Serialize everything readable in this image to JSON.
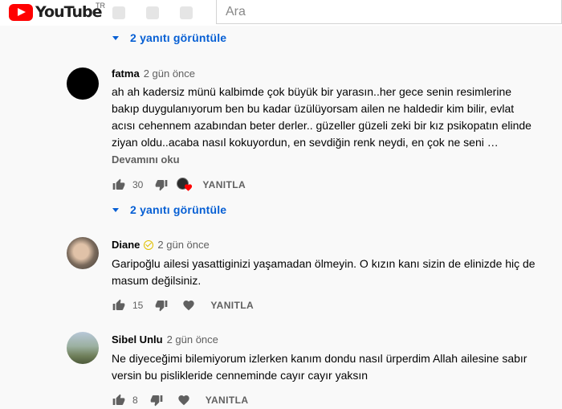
{
  "header": {
    "logo_text": "YouTube",
    "country": "TR",
    "search_placeholder": "Ara"
  },
  "reply_links": [
    {
      "label": "2 yanıtı görüntüle"
    },
    {
      "label": "2 yanıtı görüntüle"
    }
  ],
  "comments": [
    {
      "author": "fatma",
      "time": "2 gün önce",
      "verified": false,
      "lines": [
        "ah ah kadersiz münü kalbimde çok büyük bir yarasın..her gece senin resimlerine",
        "bakıp duygulanıyorum ben bu kadar üzülüyorsam ailen ne haldedir kim bilir, evlat",
        "acısı cehennem azabından beter derler.. güzeller güzeli zeki bir kız psikopatın elinde",
        "ziyan oldu..acaba nasıl kokuyordun, en sevdiğin renk neydi, en çok ne seni …"
      ],
      "read_more": "Devamını oku",
      "likes": "30",
      "reply_label": "YANITLA",
      "creator_heart": true
    },
    {
      "author": "Diane",
      "time": "2 gün önce",
      "verified": true,
      "lines": [
        "Garipoğlu ailesi yasattiginizi yaşamadan ölmeyin. O kızın kanı sizin de elinizde hiç de",
        "masum değilsiniz."
      ],
      "likes": "15",
      "reply_label": "YANITLA",
      "creator_heart": false
    },
    {
      "author": "Sibel Unlu",
      "time": "2 gün önce",
      "verified": false,
      "lines": [
        "Ne diyeceğimi bilemiyorum izlerken kanım dondu nasıl ürperdim Allah ailesine sabır",
        "versin bu pislikleride cenneminde cayır cayır yaksın"
      ],
      "likes": "8",
      "reply_label": "YANITLA",
      "creator_heart": false
    }
  ],
  "colors": {
    "accent": "#065fd4",
    "brand_red": "#ff0000",
    "heart": "#ff0000",
    "muted": "#606060"
  },
  "icons": [
    "thumbs-up-icon",
    "thumbs-down-icon",
    "heart-icon",
    "caret-down-icon",
    "verified-badge-icon"
  ]
}
